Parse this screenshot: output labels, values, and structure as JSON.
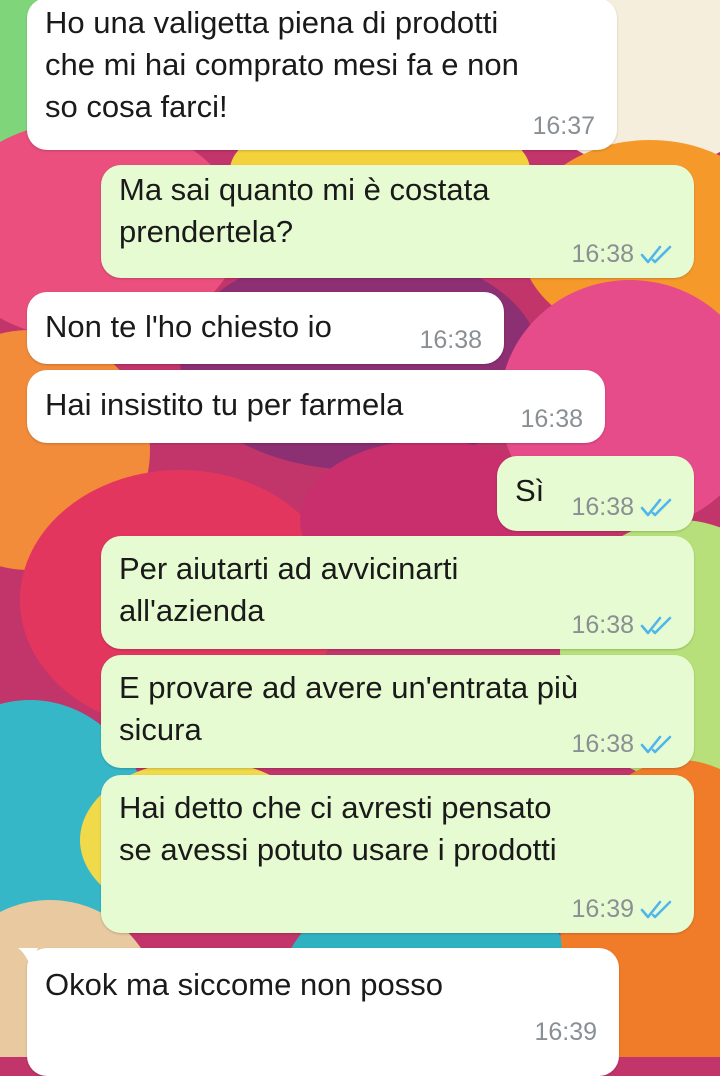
{
  "colors": {
    "incoming_bubble": "#ffffff",
    "outgoing_bubble": "#e6fbd2",
    "timestamp": "#8a8f94",
    "read_ticks": "#4fb6ec"
  },
  "wallpaper": "colorful macarons",
  "messages": [
    {
      "direction": "in",
      "text": "Ho una valigetta piena di prodotti\nche mi hai comprato mesi fa e non\nso cosa farci!",
      "time": "16:37"
    },
    {
      "direction": "out",
      "text": "Ma sai quanto mi è costata\nprendertela?",
      "time": "16:38",
      "status": "read"
    },
    {
      "direction": "in",
      "text": "Non te l'ho chiesto io",
      "time": "16:38"
    },
    {
      "direction": "in",
      "text": "Hai insistito tu per farmela",
      "time": "16:38"
    },
    {
      "direction": "out",
      "text": "Sì",
      "time": "16:38",
      "status": "read"
    },
    {
      "direction": "out",
      "text": "Per aiutarti ad avvicinarti\nall'azienda",
      "time": "16:38",
      "status": "read"
    },
    {
      "direction": "out",
      "text": "E provare ad avere un'entrata più\nsicura",
      "time": "16:38",
      "status": "read"
    },
    {
      "direction": "out",
      "text": "Hai detto che ci avresti pensato\nse avessi potuto usare i prodotti",
      "time": "16:39",
      "status": "read"
    },
    {
      "direction": "in",
      "text": "Okok ma siccome non posso",
      "time": "16:39"
    }
  ]
}
